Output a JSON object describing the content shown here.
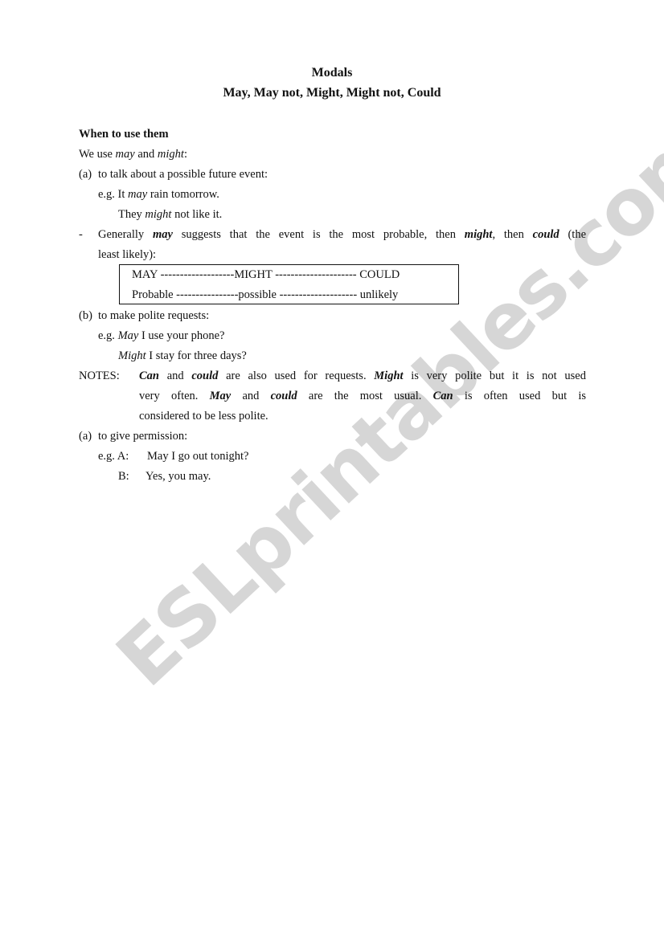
{
  "document": {
    "title": "Modals",
    "subtitle": "May, May not, Might, Might not, Could",
    "section_heading": "When to use them",
    "intro": {
      "pre": "We use ",
      "w1": "may",
      "mid": " and ",
      "w2": "might",
      "post": ":"
    },
    "point_a": {
      "label": "(a)",
      "text": "to talk about a possible future event:",
      "example1": {
        "eg": "e.g. It ",
        "modal": "may",
        "rest": " rain tomorrow."
      },
      "example2": {
        "pre": "They ",
        "modal": "might",
        "rest": " not like it."
      }
    },
    "generally": {
      "bullet": "-",
      "p1": "Generally ",
      "w1": "may",
      "p2": " suggests that the event is the most probable, then ",
      "w2": "might",
      "p3": ", then ",
      "w3": "could",
      "p4": " (the",
      "line2": "least likely):"
    },
    "scale_box": {
      "row1": "MAY -------------------MIGHT --------------------- COULD",
      "row2": "Probable ----------------possible -------------------- unlikely"
    },
    "point_b": {
      "label": "(b)",
      "text": "to make polite requests:",
      "example1": {
        "eg": "e.g. ",
        "modal": "May",
        "rest": " I use your phone?"
      },
      "example2": {
        "modal": "Might",
        "rest": " I stay for three days?"
      }
    },
    "notes": {
      "label": "NOTES:",
      "l1": {
        "w1": "Can",
        "t1": " and ",
        "w2": "could",
        "t2": " are also used for requests.   ",
        "w3": "Might",
        "t3": " is very polite but it is not used"
      },
      "l2": {
        "t0": "very often.  ",
        "w1": "May",
        "t1": " and ",
        "w2": "could",
        "t2": " are the most usual.  ",
        "w3": "Can",
        "t3": " is often used but is"
      },
      "l3": "considered to be less polite."
    },
    "point_c": {
      "label": "(a)",
      "text": "to give permission:",
      "example1": {
        "eg": "e.g. A:",
        "text": "May I go out tonight?"
      },
      "example2": {
        "eg": "B:",
        "text": "Yes, you may."
      }
    }
  },
  "watermark": "ESLprintables.com"
}
